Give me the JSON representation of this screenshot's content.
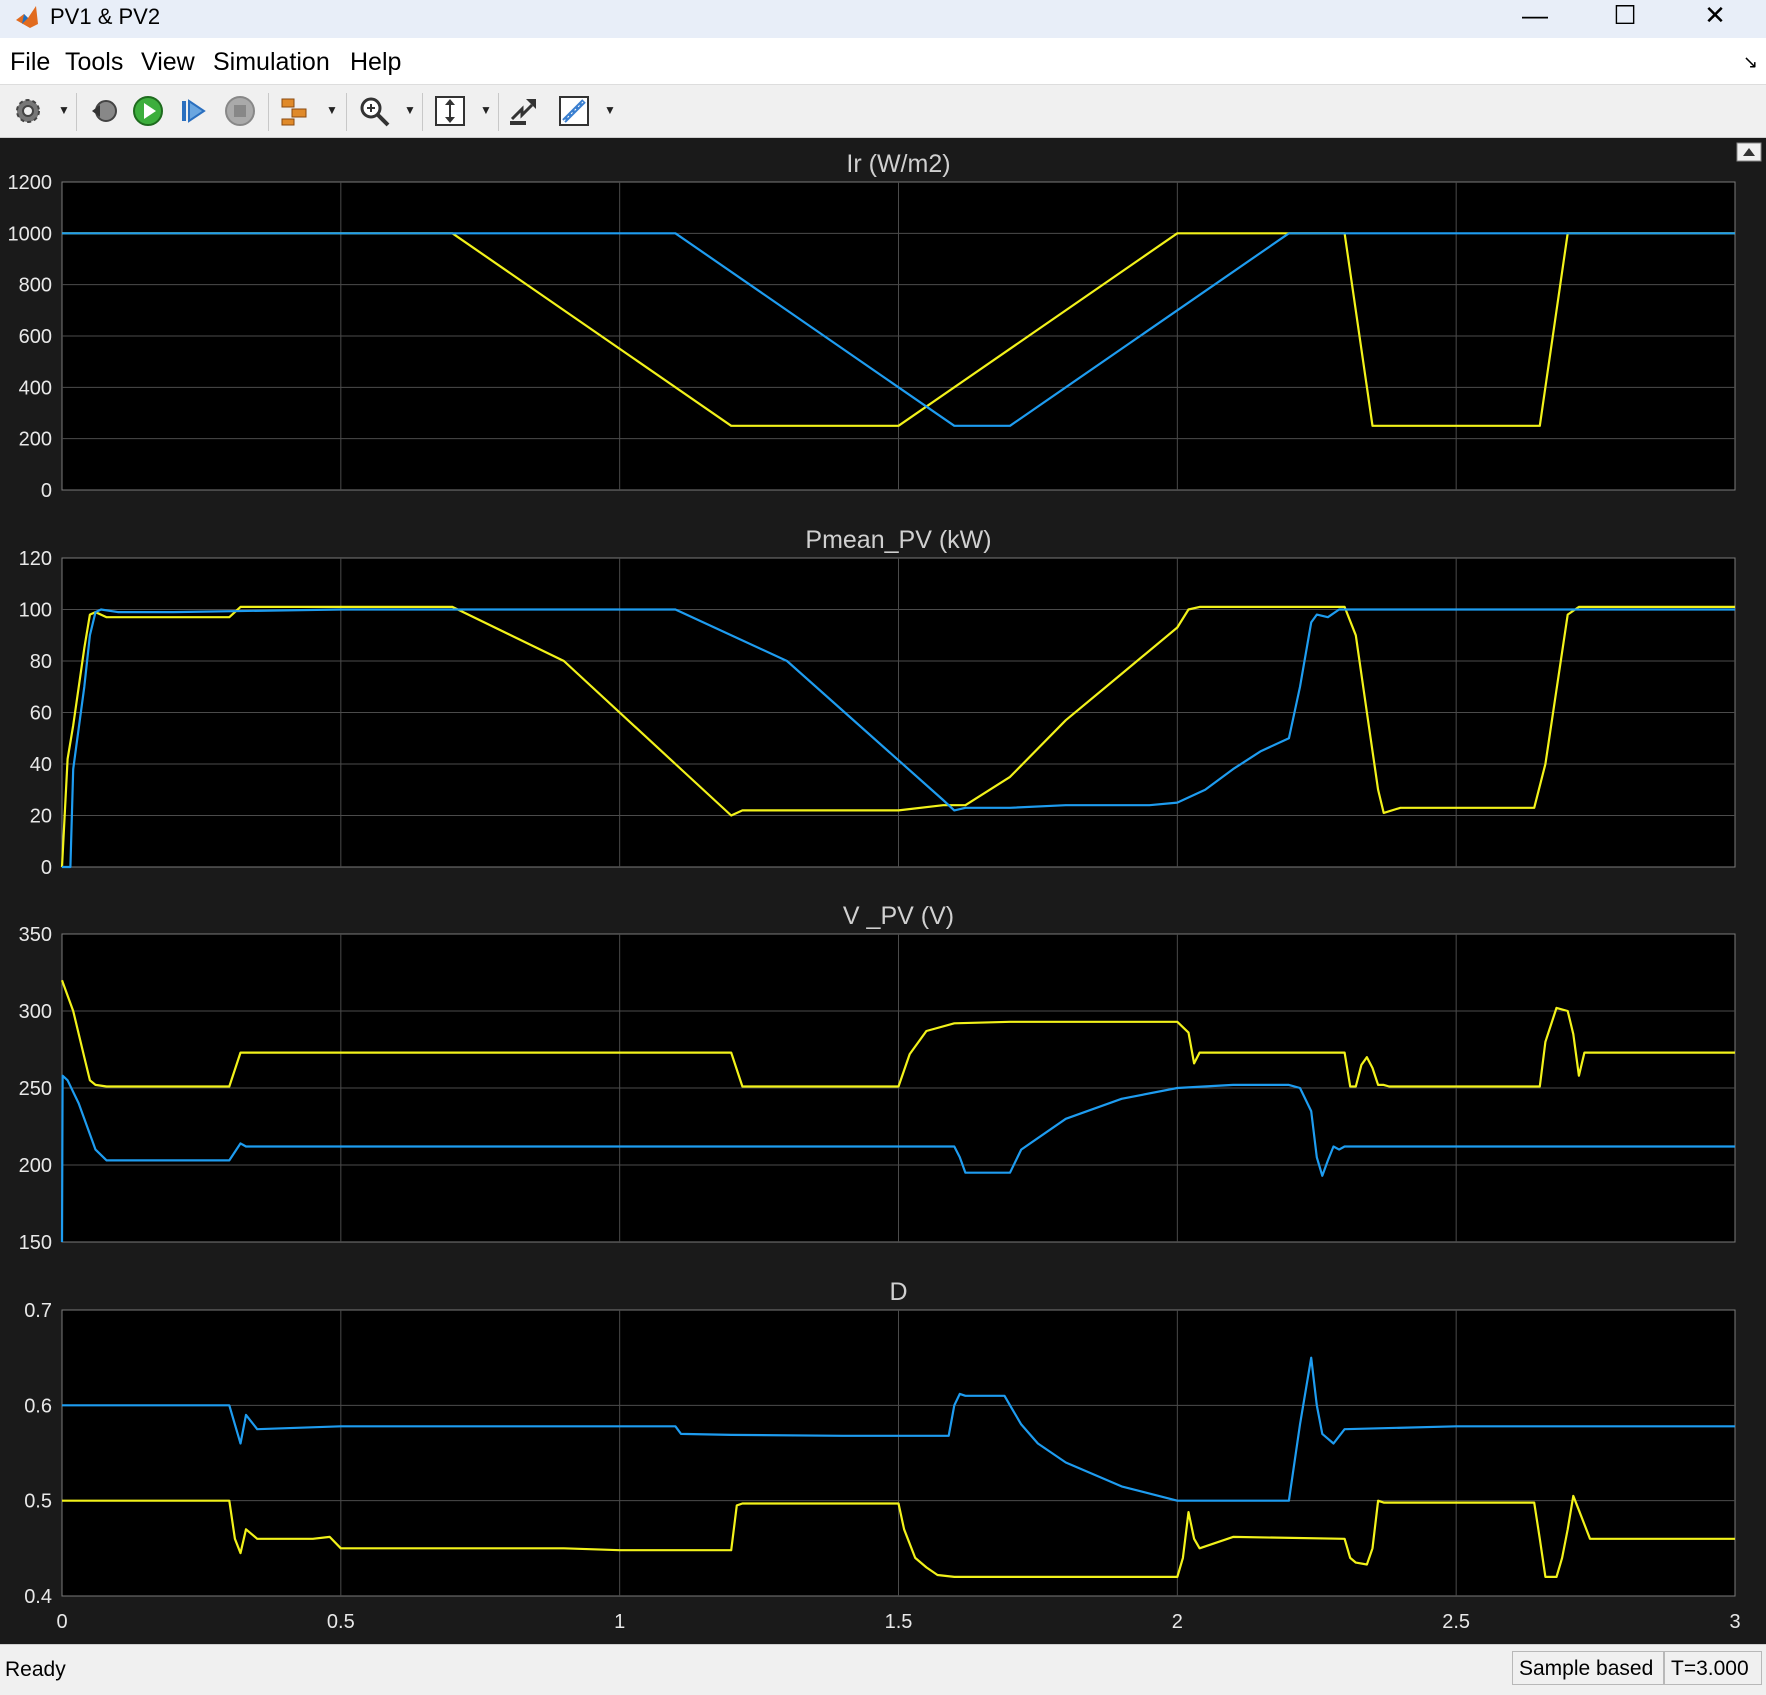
{
  "window": {
    "title": "PV1 & PV2",
    "minimize": "—",
    "maximize": "☐",
    "close": "✕"
  },
  "menu": {
    "file": "File",
    "tools": "Tools",
    "view": "View",
    "simulation": "Simulation",
    "help": "Help"
  },
  "toolbar_icons": [
    "settings-icon",
    "step-back-icon",
    "run-icon",
    "step-forward-icon",
    "stop-icon",
    "signal-select-icon",
    "zoom-icon",
    "fit-icon",
    "autoscale-icon",
    "measure-icon"
  ],
  "status": {
    "ready": "Ready",
    "mode": "Sample based",
    "time": "T=3.000"
  },
  "colors": {
    "yellow": "#f2f21a",
    "blue": "#1e9cf0",
    "bg": "#000000",
    "frame": "#1a1a1a",
    "grid": "#4b4b4b"
  },
  "chart_data": [
    {
      "type": "line",
      "title": "Ir (W/m2)",
      "xlim": [
        0,
        3
      ],
      "ylim": [
        0,
        1200
      ],
      "yticks": [
        "0",
        "200",
        "400",
        "600",
        "800",
        "1000",
        "1200"
      ],
      "grid": true,
      "series": [
        {
          "color": "yellow",
          "x": [
            0,
            0.7,
            1.2,
            1.5,
            2.0,
            2.2,
            2.3,
            2.35,
            2.65,
            2.7,
            3.0
          ],
          "y": [
            1000,
            1000,
            250,
            250,
            1000,
            1000,
            1000,
            250,
            250,
            1000,
            1000
          ]
        },
        {
          "color": "blue",
          "x": [
            0,
            1.1,
            1.6,
            1.7,
            2.2,
            3.0
          ],
          "y": [
            1000,
            1000,
            250,
            250,
            1000,
            1000
          ]
        }
      ]
    },
    {
      "type": "line",
      "title": "Pmean_PV (kW)",
      "xlim": [
        0,
        3
      ],
      "ylim": [
        0,
        120
      ],
      "yticks": [
        "0",
        "20",
        "40",
        "60",
        "80",
        "100",
        "120"
      ],
      "grid": true,
      "series": [
        {
          "color": "yellow",
          "x": [
            0,
            0.01,
            0.02,
            0.04,
            0.05,
            0.06,
            0.08,
            0.1,
            0.15,
            0.3,
            0.32,
            0.5,
            0.7,
            0.9,
            1.1,
            1.2,
            1.22,
            1.3,
            1.5,
            1.58,
            1.62,
            1.7,
            1.8,
            1.9,
            2.0,
            2.02,
            2.04,
            2.1,
            2.2,
            2.3,
            2.32,
            2.34,
            2.36,
            2.37,
            2.4,
            2.5,
            2.6,
            2.64,
            2.66,
            2.7,
            2.72,
            3.0
          ],
          "y": [
            0,
            42,
            55,
            85,
            98,
            99,
            97,
            97,
            97,
            97,
            101,
            101,
            101,
            80,
            40,
            20,
            22,
            22,
            22,
            24,
            24,
            35,
            57,
            75,
            93,
            100,
            101,
            101,
            101,
            101,
            90,
            60,
            30,
            21,
            23,
            23,
            23,
            23,
            40,
            98,
            101,
            101
          ]
        },
        {
          "color": "blue",
          "x": [
            0,
            0.015,
            0.02,
            0.04,
            0.05,
            0.06,
            0.07,
            0.1,
            0.2,
            0.5,
            1.0,
            1.1,
            1.3,
            1.58,
            1.6,
            1.62,
            1.7,
            1.8,
            1.95,
            2.0,
            2.05,
            2.1,
            2.15,
            2.2,
            2.22,
            2.24,
            2.25,
            2.27,
            2.29,
            2.3,
            3.0
          ],
          "y": [
            0,
            0,
            38,
            70,
            90,
            99,
            100,
            99,
            99,
            100,
            100,
            100,
            80,
            26,
            22,
            23,
            23,
            24,
            24,
            25,
            30,
            38,
            45,
            50,
            70,
            95,
            98,
            97,
            100,
            100,
            100
          ]
        }
      ]
    },
    {
      "type": "line",
      "title": "V _PV (V)",
      "xlim": [
        0,
        3
      ],
      "ylim": [
        150,
        350
      ],
      "yticks": [
        "150",
        "200",
        "250",
        "300",
        "350"
      ],
      "grid": true,
      "series": [
        {
          "color": "yellow",
          "x": [
            0,
            0.01,
            0.02,
            0.04,
            0.05,
            0.06,
            0.08,
            0.3,
            0.32,
            0.33,
            1.2,
            1.22,
            1.23,
            1.5,
            1.52,
            1.55,
            1.6,
            1.7,
            2.0,
            2.02,
            2.03,
            2.04,
            2.1,
            2.3,
            2.31,
            2.32,
            2.33,
            2.34,
            2.35,
            2.36,
            2.37,
            2.38,
            2.4,
            2.5,
            2.6,
            2.65,
            2.66,
            2.68,
            2.7,
            2.71,
            2.72,
            2.73,
            3.0
          ],
          "y": [
            320,
            310,
            300,
            270,
            255,
            252,
            251,
            251,
            273,
            273,
            273,
            251,
            251,
            251,
            272,
            287,
            292,
            293,
            293,
            286,
            266,
            273,
            273,
            273,
            251,
            251,
            265,
            270,
            263,
            252,
            252,
            251,
            251,
            251,
            251,
            251,
            280,
            302,
            300,
            285,
            258,
            273,
            273
          ]
        },
        {
          "color": "blue",
          "x": [
            0,
            0.001,
            0.01,
            0.03,
            0.06,
            0.08,
            0.1,
            0.3,
            0.32,
            0.33,
            1.0,
            1.5,
            1.6,
            1.61,
            1.62,
            1.7,
            1.72,
            1.8,
            1.9,
            2.0,
            2.1,
            2.2,
            2.22,
            2.24,
            2.25,
            2.26,
            2.27,
            2.28,
            2.29,
            2.3,
            3.0
          ],
          "y": [
            150,
            258,
            255,
            240,
            210,
            203,
            203,
            203,
            214,
            212,
            212,
            212,
            212,
            205,
            195,
            195,
            210,
            230,
            243,
            250,
            252,
            252,
            250,
            235,
            205,
            193,
            203,
            212,
            210,
            212,
            212
          ]
        }
      ]
    },
    {
      "type": "line",
      "title": "D",
      "xlim": [
        0,
        3
      ],
      "ylim": [
        0.4,
        0.7
      ],
      "yticks": [
        "0.4",
        "0.5",
        "0.6",
        "0.7"
      ],
      "xticks": [
        "0",
        "0.5",
        "1",
        "1.5",
        "2",
        "2.5",
        "3"
      ],
      "grid": true,
      "series": [
        {
          "color": "yellow",
          "x": [
            0,
            0.3,
            0.31,
            0.32,
            0.33,
            0.35,
            0.4,
            0.45,
            0.48,
            0.5,
            0.7,
            0.9,
            1.0,
            1.2,
            1.21,
            1.22,
            1.23,
            1.5,
            1.51,
            1.53,
            1.55,
            1.57,
            1.6,
            1.8,
            2.0,
            2.01,
            2.02,
            2.03,
            2.04,
            2.1,
            2.3,
            2.31,
            2.32,
            2.34,
            2.35,
            2.36,
            2.37,
            2.38,
            2.6,
            2.64,
            2.65,
            2.66,
            2.68,
            2.69,
            2.7,
            2.71,
            2.72,
            2.74,
            3.0
          ],
          "y": [
            0.5,
            0.5,
            0.46,
            0.445,
            0.47,
            0.46,
            0.46,
            0.46,
            0.462,
            0.45,
            0.45,
            0.45,
            0.448,
            0.448,
            0.495,
            0.497,
            0.497,
            0.497,
            0.47,
            0.44,
            0.43,
            0.422,
            0.42,
            0.42,
            0.42,
            0.44,
            0.488,
            0.46,
            0.45,
            0.462,
            0.46,
            0.44,
            0.435,
            0.433,
            0.45,
            0.5,
            0.498,
            0.498,
            0.498,
            0.498,
            0.46,
            0.42,
            0.42,
            0.44,
            0.47,
            0.505,
            0.49,
            0.46,
            0.46
          ]
        },
        {
          "color": "blue",
          "x": [
            0,
            0.3,
            0.31,
            0.32,
            0.33,
            0.35,
            0.5,
            0.8,
            1.1,
            1.11,
            1.2,
            1.4,
            1.59,
            1.6,
            1.61,
            1.62,
            1.69,
            1.7,
            1.72,
            1.75,
            1.8,
            1.9,
            2.0,
            2.1,
            2.2,
            2.22,
            2.24,
            2.25,
            2.26,
            2.28,
            2.3,
            2.5,
            2.7,
            3.0
          ],
          "y": [
            0.6,
            0.6,
            0.58,
            0.56,
            0.59,
            0.575,
            0.578,
            0.578,
            0.578,
            0.57,
            0.569,
            0.568,
            0.568,
            0.6,
            0.612,
            0.61,
            0.61,
            0.6,
            0.58,
            0.56,
            0.54,
            0.515,
            0.5,
            0.5,
            0.5,
            0.58,
            0.65,
            0.6,
            0.57,
            0.56,
            0.575,
            0.578,
            0.578,
            0.578
          ]
        }
      ]
    }
  ]
}
